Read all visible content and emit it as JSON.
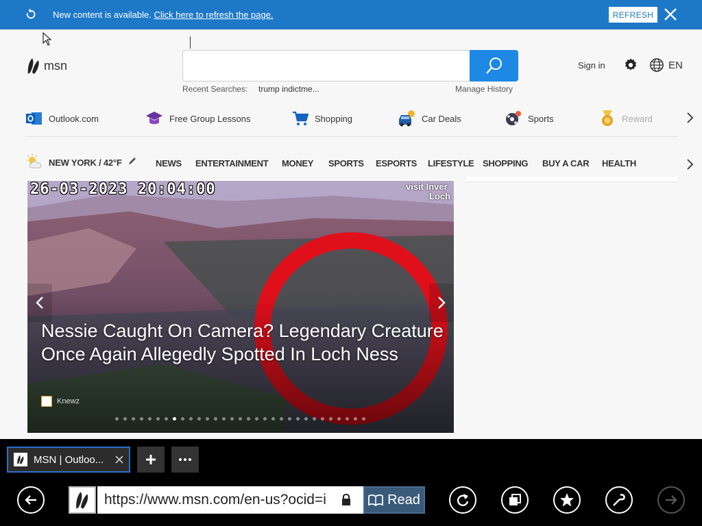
{
  "notification": {
    "message": "New content is available.",
    "link": "Click here to refresh the page.",
    "refresh_button": "REFRESH"
  },
  "header": {
    "logo_text": "msn",
    "search_placeholder": "",
    "recent_label": "Recent Searches:",
    "recent_item": "trump indictme...",
    "manage_history": "Manage History",
    "sign_in": "Sign in",
    "language": "EN"
  },
  "quick_links": [
    {
      "label": "Outlook.com",
      "icon": "outlook-icon"
    },
    {
      "label": "Free Group Lessons",
      "icon": "graduation-cap-icon"
    },
    {
      "label": "Shopping",
      "icon": "cart-icon"
    },
    {
      "label": "Car Deals",
      "icon": "car-icon"
    },
    {
      "label": "Sports",
      "icon": "ball-icon"
    },
    {
      "label": "Reward",
      "icon": "medal-icon"
    }
  ],
  "weather": {
    "text": "NEW YORK / 42°F"
  },
  "categories": [
    "NEWS",
    "ENTERTAINMENT",
    "MONEY",
    "SPORTS",
    "ESPORTS",
    "LIFESTYLE",
    "SHOPPING",
    "BUY A CAR",
    "HEALTH"
  ],
  "hero": {
    "timestamp": "26-03-2023 20:04:00",
    "watermark_line1": "visit Inver",
    "watermark_line2": "Loch",
    "headline": "Nessie Caught On Camera? Legendary Creature Once Again Allegedly Spotted In Loch Ness",
    "source": "Knewz",
    "slide_count": 31,
    "active_slide": 7
  },
  "browser": {
    "tab_title": "MSN | Outloo...",
    "url": "https://www.msn.com/en-us?ocid=i",
    "read_label": "Read"
  },
  "colors": {
    "notification_bar": "#1e78c8",
    "search_button": "#1e88e5",
    "chrome_bg": "#000000",
    "tab_border": "#2a6fc9"
  }
}
